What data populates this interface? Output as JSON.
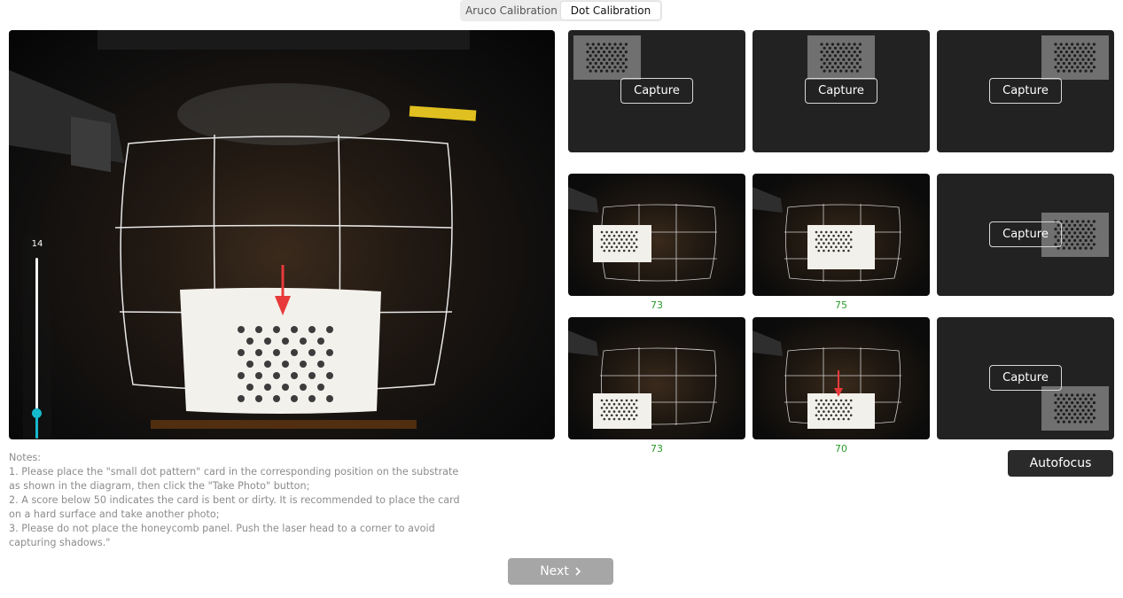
{
  "tabs": [
    {
      "label": "Aruco Calibration",
      "active": false
    },
    {
      "label": "Dot Calibration",
      "active": true
    }
  ],
  "camera": {
    "brightness_value": "14",
    "brightness_fraction": 0.14,
    "brightness_icon": "brightness-icon",
    "warning_sticker": "WARNING"
  },
  "slots": [
    {
      "captured": false,
      "button": "Capture",
      "score": ""
    },
    {
      "captured": false,
      "button": "Capture",
      "score": ""
    },
    {
      "captured": false,
      "button": "Capture",
      "score": ""
    },
    {
      "captured": true,
      "button": "",
      "score": "73"
    },
    {
      "captured": true,
      "button": "",
      "score": "75"
    },
    {
      "captured": false,
      "button": "Capture",
      "score": ""
    },
    {
      "captured": true,
      "button": "",
      "score": "73"
    },
    {
      "captured": true,
      "button": "",
      "score": "70"
    },
    {
      "captured": false,
      "button": "Capture",
      "score": ""
    }
  ],
  "autofocus_label": "Autofocus",
  "notes": {
    "heading": "Notes:",
    "items": [
      "1. Please place the \"small dot pattern\" card in the corresponding position on the substrate as shown in the diagram, then click the \"Take Photo\" button;",
      "2. A score below 50 indicates the card is bent or dirty. It is recommended to place the card on a hard surface and take another photo;",
      "3. Please do not place the honeycomb panel. Push the laser head to a corner to avoid capturing shadows.\""
    ]
  },
  "next": {
    "label": "Next",
    "icon": "chevron-right-icon"
  },
  "colors": {
    "accent": "#16b8cc",
    "score": "#2a9a2a",
    "arrow": "#e83a3a"
  }
}
